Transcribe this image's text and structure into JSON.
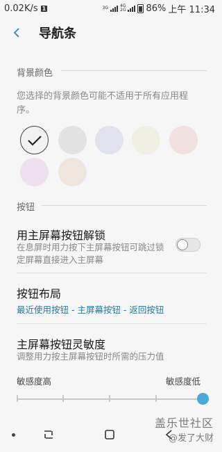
{
  "status_bar": {
    "speed": "0.02K/s",
    "sim_badge": "1",
    "net1": "3G",
    "net2_top": "4G",
    "net2_bottom": "2G",
    "battery": "86%",
    "time": "上午 11:34"
  },
  "header": {
    "title": "导航条"
  },
  "background_color": {
    "section_label": "背景颜色",
    "hint": "您选择的背景颜色可能不适用于所有应用程序。",
    "swatches": [
      {
        "color": "#f2f2f2",
        "selected": true
      },
      {
        "color": "#e2e2e2",
        "selected": false
      },
      {
        "color": "#e2e2ee",
        "selected": false
      },
      {
        "color": "#eeeee2",
        "selected": false
      },
      {
        "color": "#f0e0e0",
        "selected": false
      },
      {
        "color": "#eee0ee",
        "selected": false
      },
      {
        "color": "#eee6dc",
        "selected": false
      }
    ]
  },
  "buttons": {
    "section_label": "按钮",
    "unlock": {
      "title": "用主屏幕按钮解锁",
      "subtitle": "在息屏时用力按下主屏幕按钮可跳过锁定屏幕直接进入主屏幕",
      "toggle_on": false
    },
    "layout": {
      "title": "按钮布局",
      "value": "最近使用按钮 - 主屏幕按钮 - 返回按钮"
    },
    "sensitivity": {
      "title": "主屏幕按钮灵敏度",
      "subtitle": "调整用力按主屏幕按钮时所需的压力值",
      "label_high": "敏感度高",
      "label_low": "敏感度低",
      "level": 1.0
    }
  },
  "watermark": {
    "top": "盖乐世社区",
    "bottom": "@发了大财"
  },
  "colors": {
    "accent": "#4aa9d6",
    "link": "#2b7a9c"
  }
}
